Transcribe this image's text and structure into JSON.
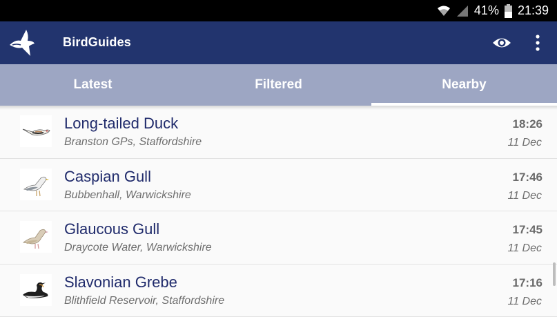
{
  "status": {
    "battery": "41%",
    "time": "21:39",
    "icons": [
      "wifi-icon",
      "signal-icon",
      "battery-icon"
    ]
  },
  "appbar": {
    "title": "BirdGuides",
    "icons": [
      "bird-logo-icon",
      "eye-icon",
      "more-vert-icon"
    ]
  },
  "tabs": [
    {
      "label": "Latest"
    },
    {
      "label": "Filtered"
    },
    {
      "label": "Nearby",
      "selected": true
    }
  ],
  "sightings": [
    {
      "name": "Long-tailed Duck",
      "location": "Branston GPs, Staffordshire",
      "time": "18:26",
      "date": "11 Dec",
      "icon": "duck-icon"
    },
    {
      "name": "Caspian Gull",
      "location": "Bubbenhall, Warwickshire",
      "time": "17:46",
      "date": "11 Dec",
      "icon": "gull-icon"
    },
    {
      "name": "Glaucous Gull",
      "location": "Draycote Water, Warwickshire",
      "time": "17:45",
      "date": "11 Dec",
      "icon": "gull-icon"
    },
    {
      "name": "Slavonian Grebe",
      "location": "Blithfield Reservoir, Staffordshire",
      "time": "17:16",
      "date": "11 Dec",
      "icon": "grebe-icon"
    }
  ],
  "colors": {
    "appbar": "#22346e",
    "tabbar": "#9da6c3",
    "name_text": "#1f2a6b"
  }
}
